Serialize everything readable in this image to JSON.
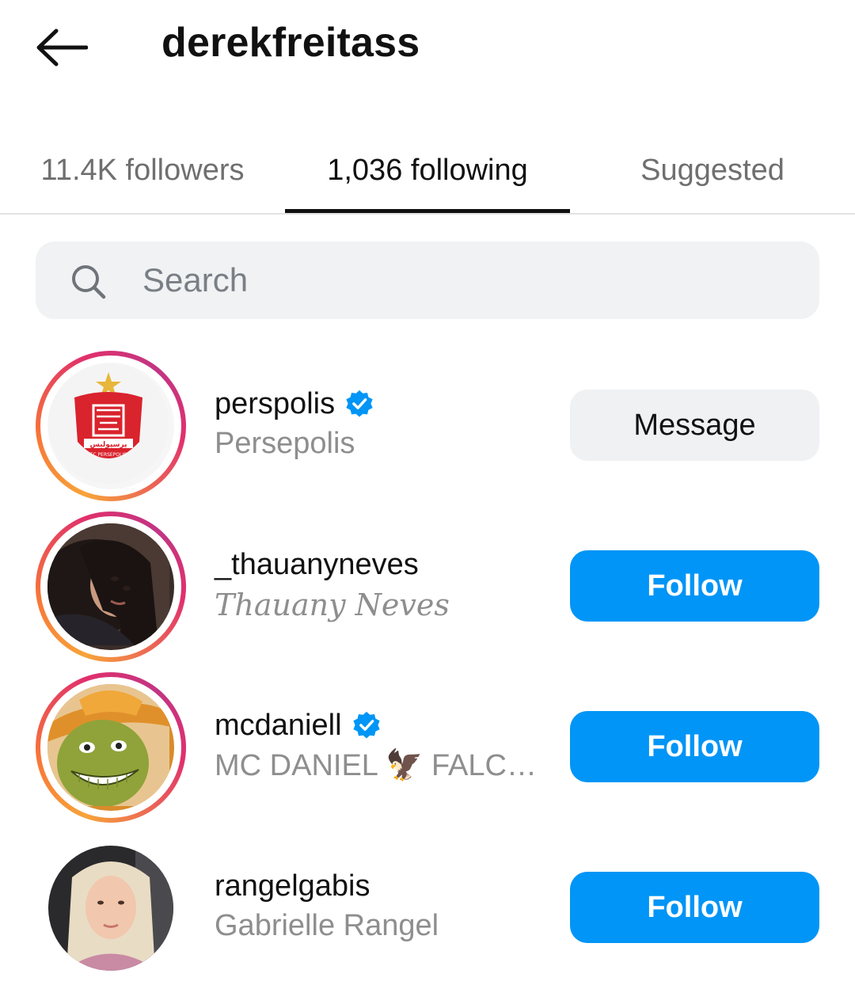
{
  "header": {
    "back_icon": "arrow-left-icon",
    "username": "derekfreitass"
  },
  "tabs": [
    {
      "label": "11.4K followers",
      "active": false
    },
    {
      "label": "1,036 following",
      "active": true
    },
    {
      "label": "Suggested",
      "active": false
    }
  ],
  "search": {
    "placeholder": "Search",
    "icon": "search-icon"
  },
  "accounts": [
    {
      "handle": "perspolis",
      "full_name": "Persepolis",
      "verified": true,
      "has_story_ring": true,
      "button": "Message",
      "avatar_text": "FC PERSEPOLIS"
    },
    {
      "handle": "_thauanyneves",
      "full_name": "Thauany Neves",
      "verified": false,
      "has_story_ring": true,
      "button": "Follow"
    },
    {
      "handle": "mcdaniell",
      "full_name": "MC DANIEL 🦅 FALCÃ...",
      "verified": true,
      "has_story_ring": true,
      "button": "Follow"
    },
    {
      "handle": "rangelgabis",
      "full_name": "Gabrielle Rangel",
      "verified": false,
      "has_story_ring": false,
      "button": "Follow"
    }
  ],
  "colors": {
    "follow_button": "#0095f6",
    "verified_badge": "#0095f6",
    "tab_indicator": "#111111"
  }
}
